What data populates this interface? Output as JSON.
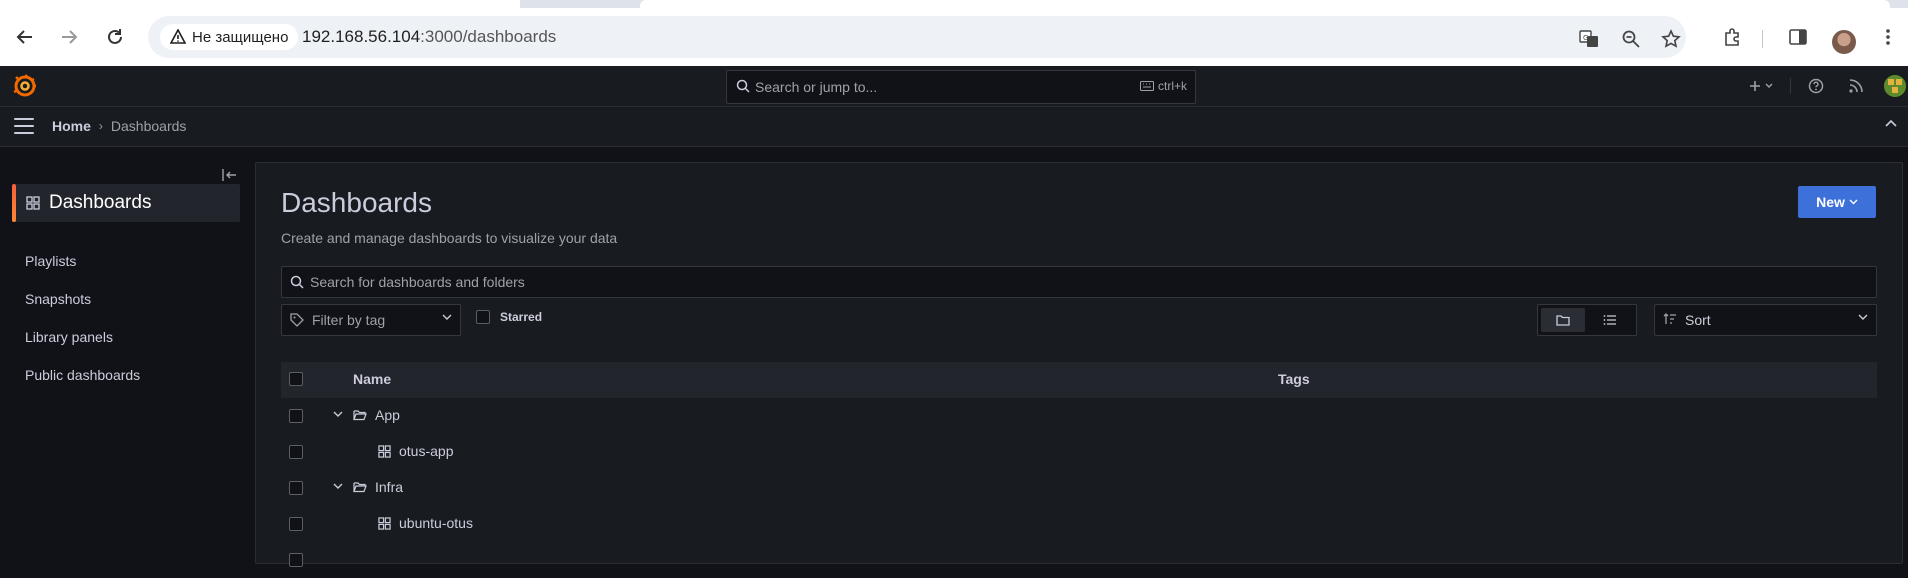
{
  "browser": {
    "security_label": "Не защищено",
    "url_host": "192.168.56.104",
    "url_path": ":3000/dashboards"
  },
  "topbar": {
    "search_placeholder": "Search or jump to...",
    "search_shortcut": "ctrl+k"
  },
  "breadcrumb": {
    "home": "Home",
    "current": "Dashboards"
  },
  "sidebar": {
    "active_label": "Dashboards",
    "items": [
      {
        "label": "Playlists"
      },
      {
        "label": "Snapshots"
      },
      {
        "label": "Library panels"
      },
      {
        "label": "Public dashboards"
      }
    ]
  },
  "page": {
    "title": "Dashboards",
    "subtitle": "Create and manage dashboards to visualize your data",
    "new_button": "New",
    "search_placeholder": "Search for dashboards and folders",
    "tag_filter_placeholder": "Filter by tag",
    "starred_label": "Starred",
    "sort_placeholder": "Sort"
  },
  "table": {
    "columns": [
      "Name",
      "Tags"
    ],
    "rows": [
      {
        "label": "App",
        "type": "folder"
      },
      {
        "label": "otus-app",
        "type": "dashboard"
      },
      {
        "label": "Infra",
        "type": "folder"
      },
      {
        "label": "ubuntu-otus",
        "type": "dashboard"
      }
    ]
  },
  "colors": {
    "accent": "#3d71d9",
    "brand": "#f55f3e"
  }
}
